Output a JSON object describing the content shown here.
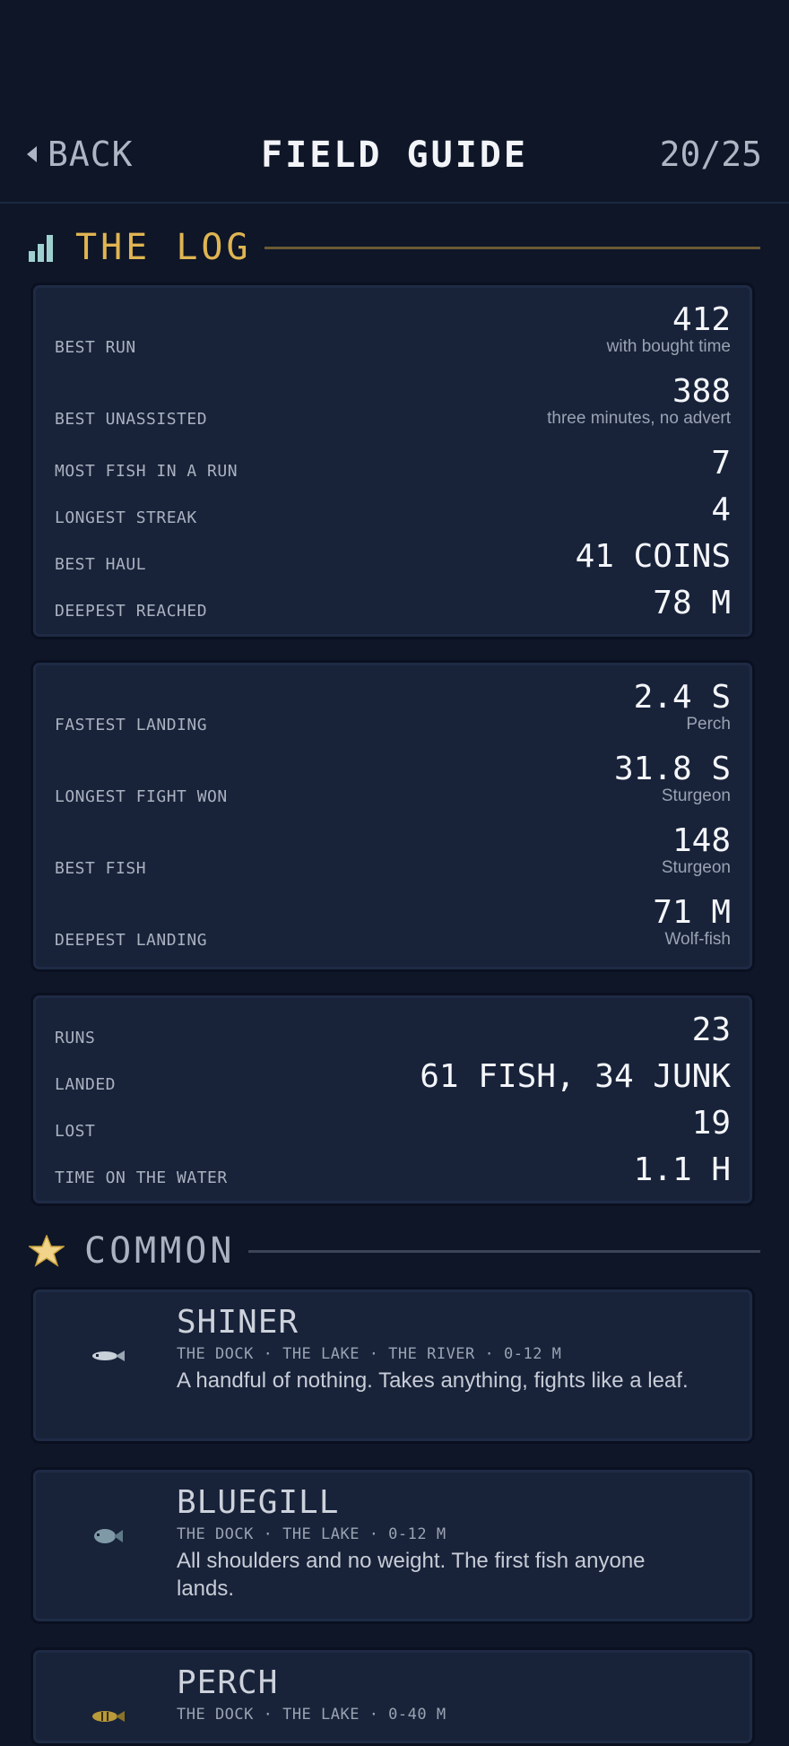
{
  "header": {
    "back_label": "BACK",
    "title": "FIELD GUIDE",
    "count": "20/25"
  },
  "log": {
    "title": "THE LOG",
    "accent": "#e0b451",
    "card1": [
      {
        "label": "BEST RUN",
        "value": "412",
        "sub": "with bought time"
      },
      {
        "label": "BEST UNASSISTED",
        "value": "388",
        "sub": "three minutes, no advert"
      },
      {
        "label": "MOST FISH IN A RUN",
        "value": "7"
      },
      {
        "label": "LONGEST STREAK",
        "value": "4"
      },
      {
        "label": "BEST HAUL",
        "value": "41 COINS"
      },
      {
        "label": "DEEPEST REACHED",
        "value": "78 M"
      }
    ],
    "card2": [
      {
        "label": "FASTEST LANDING",
        "value": "2.4 S",
        "sub": "Perch"
      },
      {
        "label": "LONGEST FIGHT WON",
        "value": "31.8 S",
        "sub": "Sturgeon"
      },
      {
        "label": "BEST FISH",
        "value": "148",
        "sub": "Sturgeon"
      },
      {
        "label": "DEEPEST LANDING",
        "value": "71 M",
        "sub": "Wolf-fish"
      }
    ],
    "card3": [
      {
        "label": "RUNS",
        "value": "23"
      },
      {
        "label": "LANDED",
        "value": "61 FISH, 34 JUNK"
      },
      {
        "label": "LOST",
        "value": "19"
      },
      {
        "label": "TIME ON THE WATER",
        "value": "1.1 H"
      }
    ]
  },
  "common": {
    "title": "COMMON",
    "icon": "star-icon",
    "fish": [
      {
        "name": "SHINER",
        "locations": "THE DOCK · THE LAKE · THE RIVER · 0-12 M",
        "description": "A handful of nothing. Takes anything, fights like a leaf."
      },
      {
        "name": "BLUEGILL",
        "locations": "THE DOCK · THE LAKE · 0-12 M",
        "description": "All shoulders and no weight. The first fish anyone lands."
      },
      {
        "name": "PERCH",
        "locations": "THE DOCK · THE LAKE · 0-40 M",
        "description": ""
      }
    ]
  }
}
